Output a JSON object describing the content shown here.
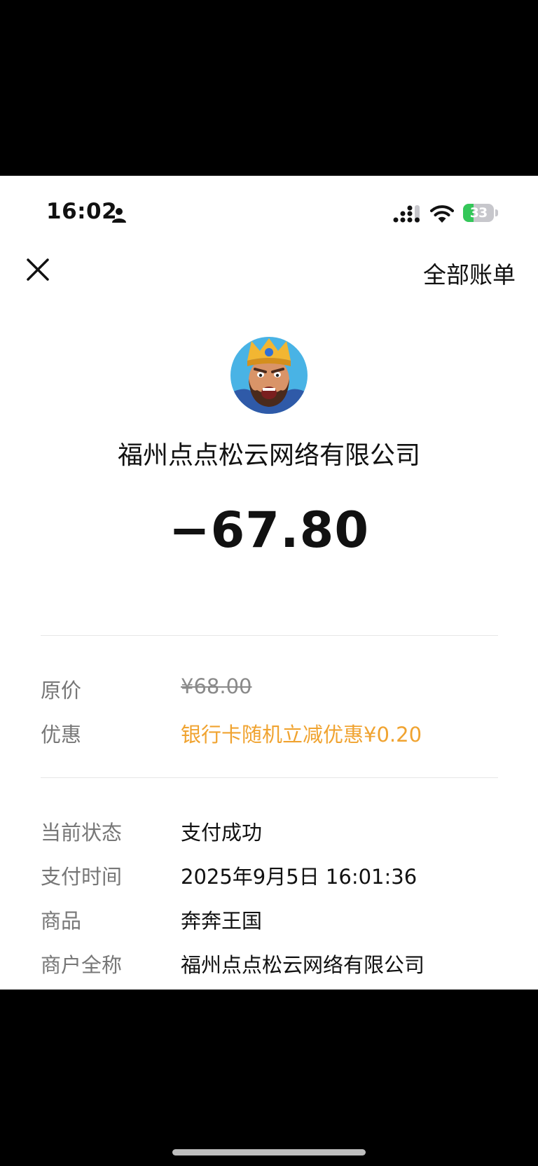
{
  "status_bar": {
    "time": "16:02",
    "battery": "33",
    "battery_level": 0.33
  },
  "nav": {
    "all_bills_label": "全部账单"
  },
  "merchant": {
    "name": "福州点点松云网络有限公司",
    "amount": "−67.80"
  },
  "pricing": [
    {
      "label": "原价",
      "value": "¥68.00",
      "style": "strike"
    },
    {
      "label": "优惠",
      "value": "银行卡随机立减优惠¥0.20",
      "style": "orange"
    }
  ],
  "details": [
    {
      "label": "当前状态",
      "value": "支付成功"
    },
    {
      "label": "支付时间",
      "value": "2025年9月5日 16:01:36"
    },
    {
      "label": "商品",
      "value": "奔奔王国"
    },
    {
      "label": "商户全称",
      "value": "福州点点松云网络有限公司"
    }
  ],
  "colors": {
    "discount": "#f0a330",
    "battery_fill": "#34c759"
  }
}
